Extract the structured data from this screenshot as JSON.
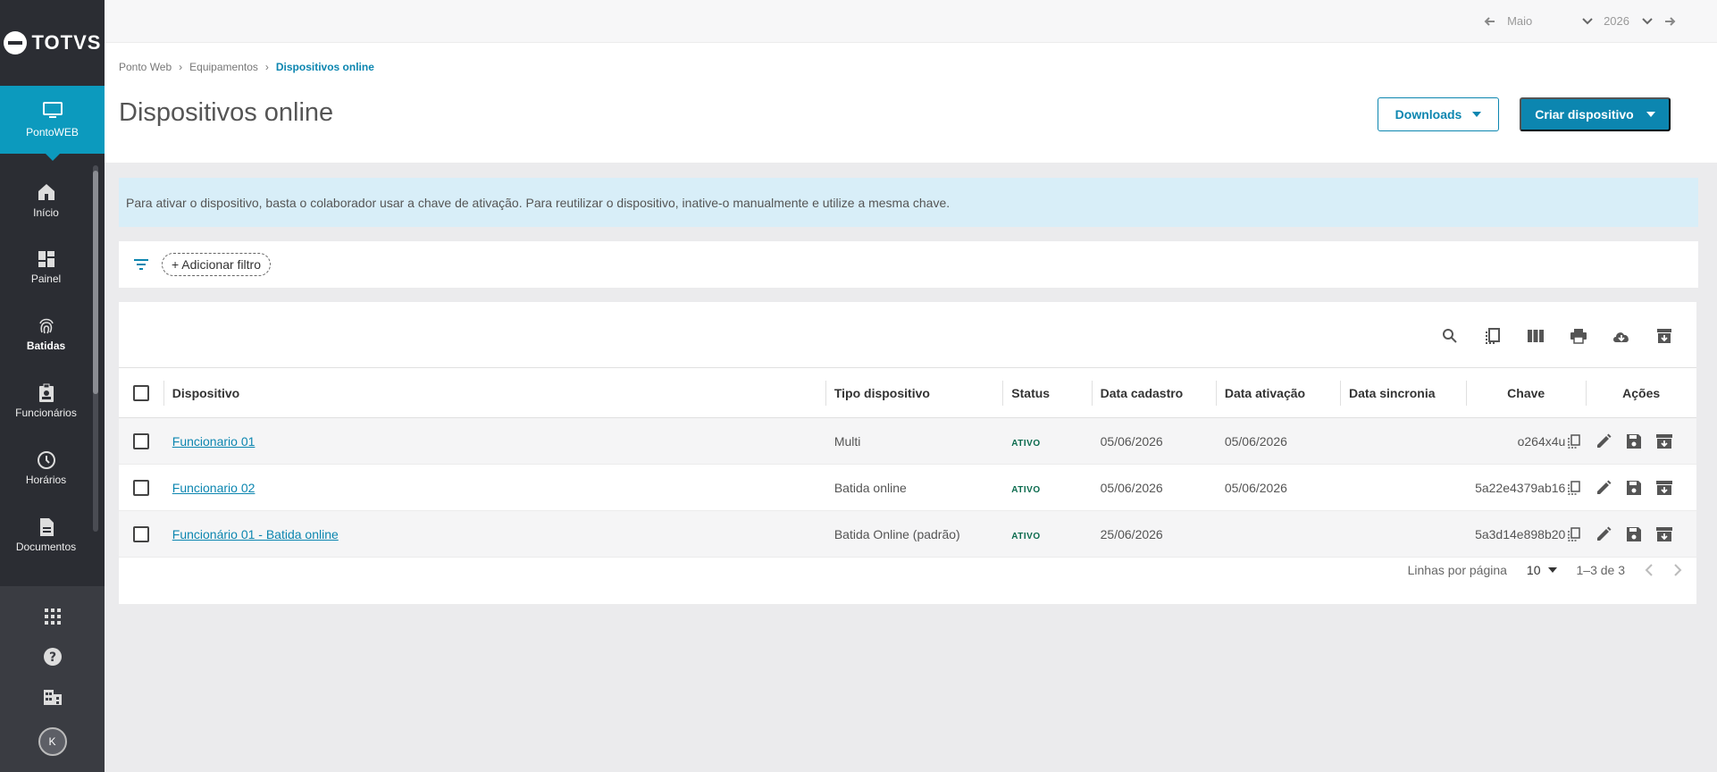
{
  "sidebar": {
    "logo_text": "TOTVS",
    "module_label": "PontoWEB",
    "items": [
      {
        "label": "Início",
        "icon": "home-icon"
      },
      {
        "label": "Painel",
        "icon": "dashboard-icon"
      },
      {
        "label": "Batidas",
        "icon": "fingerprint-icon"
      },
      {
        "label": "Funcionários",
        "icon": "badge-icon"
      },
      {
        "label": "Horários",
        "icon": "clock-icon"
      },
      {
        "label": "Documentos",
        "icon": "document-icon"
      }
    ],
    "avatar_initial": "K"
  },
  "topbar": {
    "month": "Maio",
    "year": "2026"
  },
  "breadcrumb": [
    "Ponto Web",
    "Equipamentos",
    "Dispositivos online"
  ],
  "page_title": "Dispositivos online",
  "buttons": {
    "downloads": "Downloads",
    "create": "Criar dispositivo"
  },
  "info_text": "Para ativar o dispositivo, basta o colaborador usar a chave de ativação. Para reutilizar o dispositivo, inative-o manualmente e utilize a mesma chave.",
  "filter": {
    "add_label": "+ Adicionar filtro"
  },
  "table": {
    "headers": [
      "Dispositivo",
      "Tipo dispositivo",
      "Status",
      "Data cadastro",
      "Data ativação",
      "Data sincronia",
      "Chave",
      "Ações"
    ],
    "rows": [
      {
        "name": "Funcionario 01",
        "type": "Multi",
        "status": "ATIVO",
        "created": "05/06/2026",
        "activated": "05/06/2026",
        "synced": "",
        "key": "o264x4u"
      },
      {
        "name": "Funcionario 02",
        "type": "Batida online",
        "status": "ATIVO",
        "created": "05/06/2026",
        "activated": "05/06/2026",
        "synced": "",
        "key": "5a22e4379ab16"
      },
      {
        "name": "Funcionário 01 - Batida online",
        "type": "Batida Online (padrão)",
        "status": "ATIVO",
        "created": "25/06/2026",
        "activated": "",
        "synced": "",
        "key": "5a3d14e898b20"
      }
    ]
  },
  "pagination": {
    "rows_label": "Linhas por página",
    "rows_value": "10",
    "range": "1–3 de 3"
  },
  "colors": {
    "primary": "#0c86b0",
    "sidebar": "#2b2d33",
    "module": "#0c9abe",
    "info_bg": "#d8eef8"
  }
}
